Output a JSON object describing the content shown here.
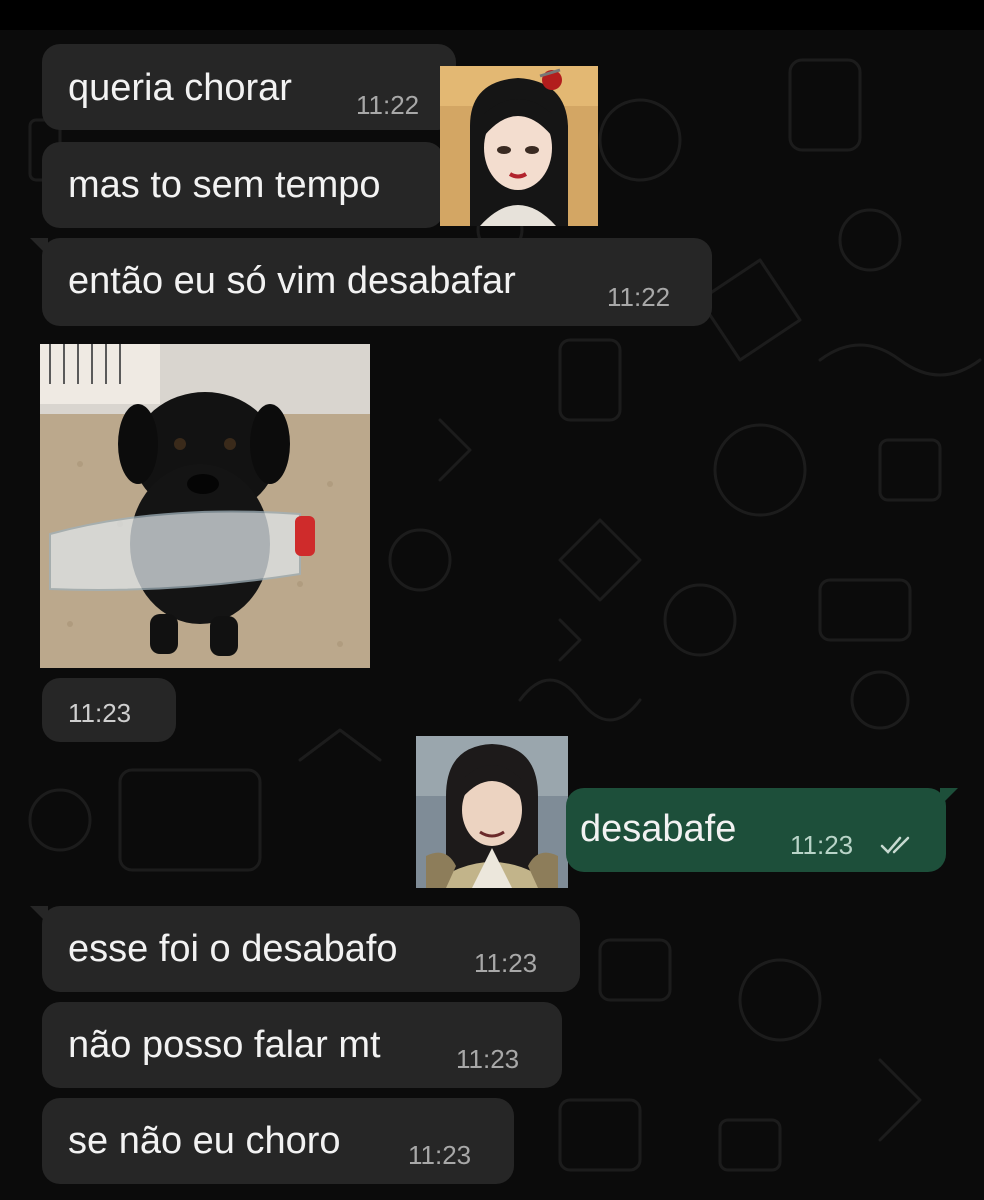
{
  "messages": [
    {
      "type": "text",
      "direction": "in",
      "text": "queria chorar",
      "time": "11:22"
    },
    {
      "type": "text",
      "direction": "in",
      "text": "mas to sem tempo",
      "time": ""
    },
    {
      "type": "text",
      "direction": "in",
      "text": "então eu só vim desabafar",
      "time": "11:22"
    },
    {
      "type": "image",
      "direction": "in",
      "caption_time": "11:23"
    },
    {
      "type": "text",
      "direction": "out",
      "text": "desabafe",
      "time": "11:23",
      "status": "read"
    },
    {
      "type": "text",
      "direction": "in",
      "text": "esse foi o desabafo",
      "time": "11:23"
    },
    {
      "type": "text",
      "direction": "in",
      "text": "não posso falar mt",
      "time": "11:23"
    },
    {
      "type": "text",
      "direction": "in",
      "text": "se não eu choro",
      "time": "11:23"
    }
  ],
  "colors": {
    "background": "#0b0b0b",
    "incoming_bubble": "#262626",
    "outgoing_bubble": "#1d4f3a",
    "text": "#f2f2f2",
    "timestamp": "#a8a8a8",
    "read_ticks": "#c7d9d0"
  },
  "icons": {
    "read_receipt": "double-check-icon"
  }
}
